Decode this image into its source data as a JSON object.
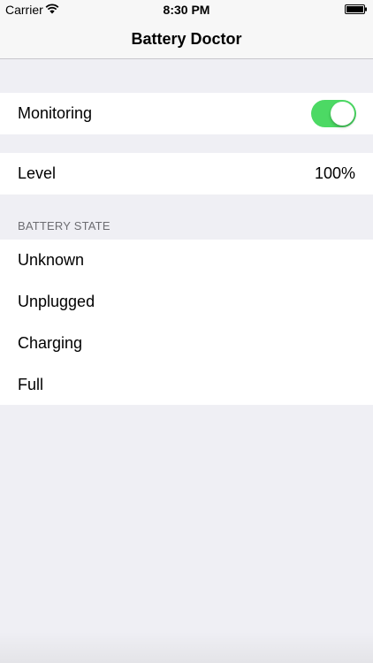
{
  "status_bar": {
    "carrier": "Carrier",
    "time": "8:30 PM",
    "wifi_icon": "wifi-icon",
    "battery_icon": "battery-full-icon"
  },
  "nav": {
    "title": "Battery Doctor"
  },
  "monitoring": {
    "label": "Monitoring",
    "enabled": true,
    "toggle_color": "#4cd964"
  },
  "level": {
    "label": "Level",
    "value": "100%"
  },
  "battery_state": {
    "header": "BATTERY STATE",
    "items": [
      {
        "label": "Unknown"
      },
      {
        "label": "Unplugged"
      },
      {
        "label": "Charging"
      },
      {
        "label": "Full"
      }
    ]
  },
  "colors": {
    "background": "#efeff4",
    "section_header": "#6d6d72",
    "nav_bar": "#f7f7f7"
  }
}
